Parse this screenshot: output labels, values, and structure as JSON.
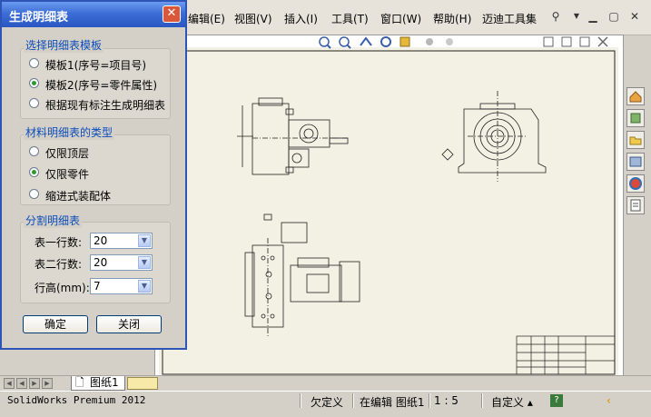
{
  "menubar": {
    "items": [
      "编辑(E)",
      "视图(V)",
      "插入(I)",
      "工具(T)",
      "窗口(W)",
      "帮助(H)",
      "迈迪工具集"
    ]
  },
  "dialog": {
    "title": "生成明细表",
    "group_template": {
      "title": "选择明细表模板",
      "options": [
        "模板1(序号=项目号)",
        "模板2(序号=零件属性)",
        "根据现有标注生成明细表"
      ],
      "selected": 1
    },
    "group_type": {
      "title": "材料明细表的类型",
      "options": [
        "仅限顶层",
        "仅限零件",
        "缩进式装配体"
      ],
      "selected": 1
    },
    "group_split": {
      "title": "分割明细表",
      "rows": [
        {
          "label": "表一行数:",
          "value": "20"
        },
        {
          "label": "表二行数:",
          "value": "20"
        },
        {
          "label": "行高(mm):",
          "value": "7"
        }
      ]
    },
    "ok_label": "确定",
    "close_label": "关闭"
  },
  "sheet_tab": "图纸1",
  "status": {
    "product": "SolidWorks Premium 2012",
    "definition": "欠定义",
    "editing": "在编辑 图纸1",
    "scale": "1 : 5",
    "custom": "自定义 ▴"
  },
  "colors": {
    "title_bar": "#3c6dd6",
    "group_title": "#0b4dbb",
    "radio_dot": "#2e9a2e"
  }
}
